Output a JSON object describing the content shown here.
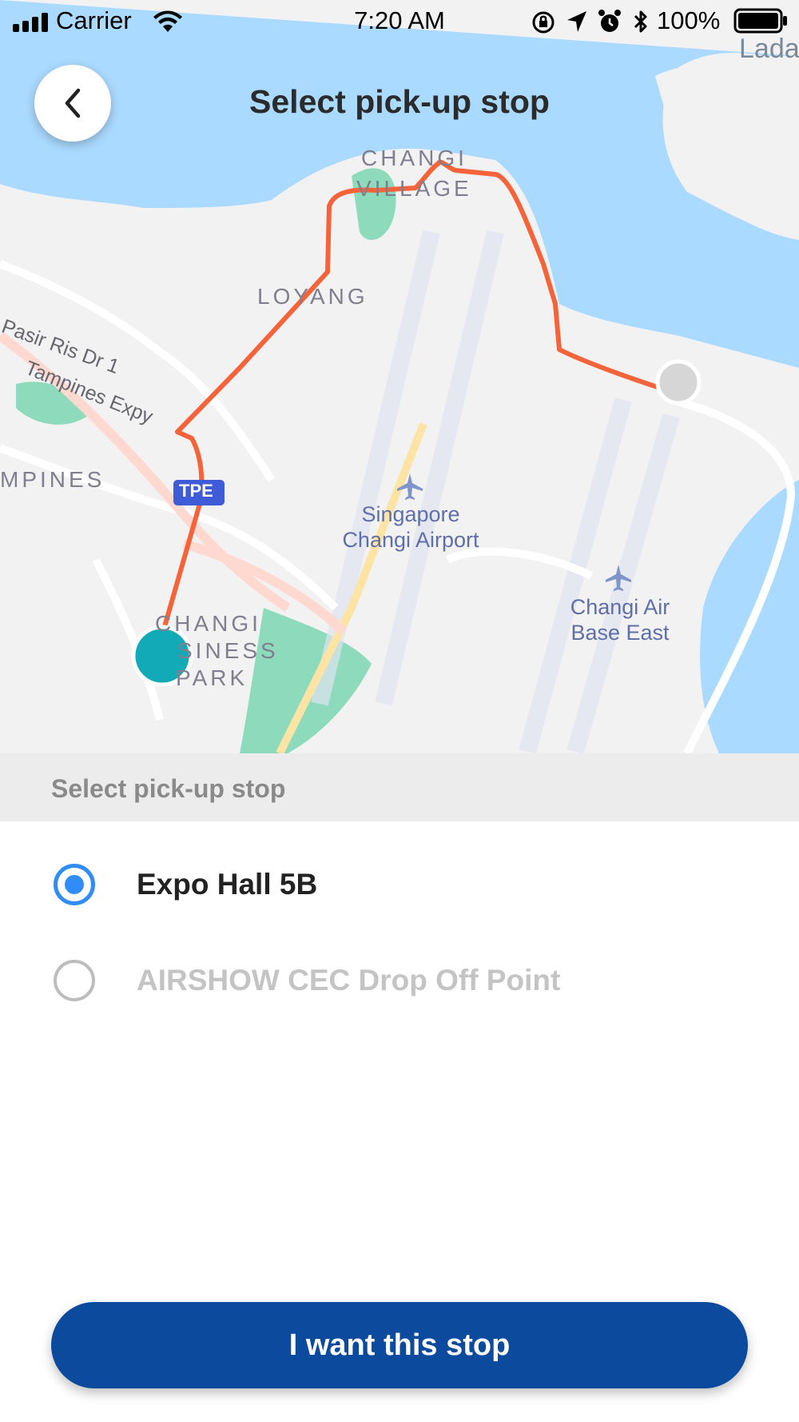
{
  "status_bar": {
    "carrier": "Carrier",
    "time": "7:20 AM",
    "battery": "100%"
  },
  "header": {
    "title": "Select pick-up stop",
    "back_icon": "chevron-left-icon"
  },
  "map": {
    "labels": {
      "lada": "Lada",
      "changi_village_1": "CHANGI",
      "changi_village_2": "VILLAGE",
      "loyang": "LOYANG",
      "pasir_ris": "Pasir Ris Dr 1",
      "tampines_expy": "Tampines Expy",
      "tampines": "MPINES",
      "tpe": "TPE",
      "airport_1": "Singapore",
      "airport_2": "Changi Airport",
      "airbase_1": "Changi Air",
      "airbase_2": "Base East",
      "cbp_1": "CHANGI",
      "cbp_2": "SINESS",
      "cbp_3": "PARK"
    },
    "route_color": "#f4633a",
    "start_marker_color": "#13aab8",
    "end_marker_color": "#d6d6d6"
  },
  "section": {
    "heading": "Select pick-up stop"
  },
  "options": [
    {
      "label": "Expo Hall 5B",
      "selected": true
    },
    {
      "label": "AIRSHOW CEC Drop Off Point",
      "selected": false
    }
  ],
  "cta": {
    "label": "I want this stop"
  },
  "colors": {
    "accent": "#2f8df5",
    "primary_button": "#0b4a9c",
    "water": "#aadaff",
    "land": "#f2f2f2",
    "park": "#8ddbbc"
  }
}
